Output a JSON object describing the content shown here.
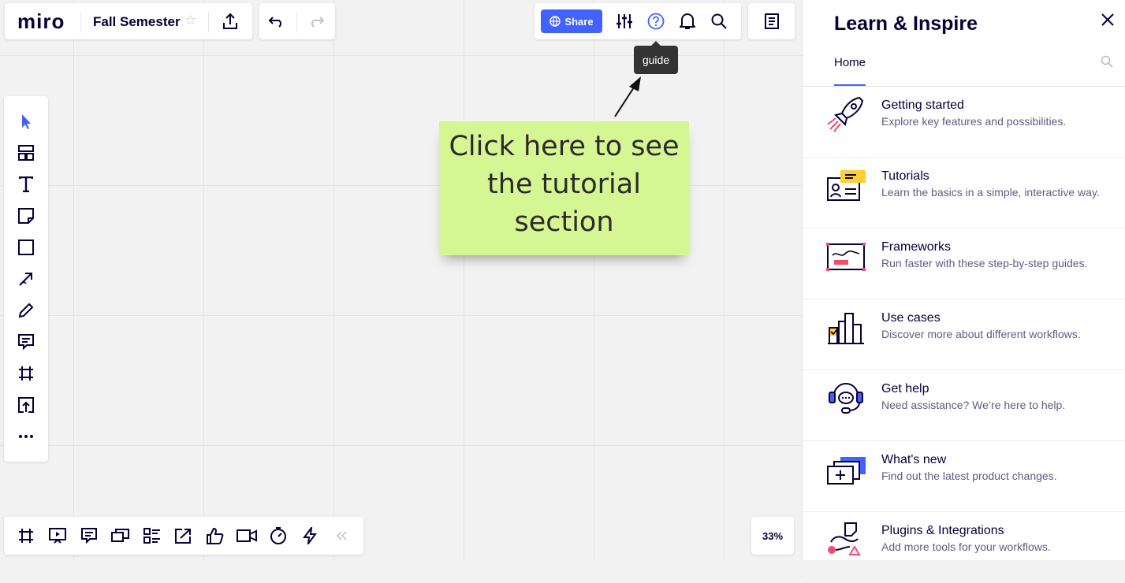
{
  "app": {
    "logo": "miro"
  },
  "board": {
    "title": "Fall Semester"
  },
  "top_bar": {
    "share_label": "Share"
  },
  "tooltip": {
    "text": "guide"
  },
  "sticky_note": {
    "text": "Click here to see the tutorial section",
    "color": "#d5f692"
  },
  "left_toolbar": {
    "tools": [
      "select-icon",
      "templates-icon",
      "text-icon",
      "sticky-note-icon",
      "shape-icon",
      "arrow-icon",
      "pen-icon",
      "comment-icon",
      "frame-icon",
      "upload-icon",
      "more-icon"
    ],
    "accent": "#4262ff"
  },
  "bottom_bar": {
    "tools": [
      "frames-icon",
      "presentation-icon",
      "comments-icon",
      "video-chat-icon",
      "card-icon",
      "screen-share-icon",
      "voting-icon",
      "video-icon",
      "timer-icon",
      "lightning-icon",
      "collapse-icon"
    ]
  },
  "zoom": {
    "level": "33%"
  },
  "sidebar": {
    "title": "Learn & Inspire",
    "tab": "Home",
    "items": [
      {
        "title": "Getting started",
        "desc": "Explore key features and possibilities.",
        "icon": "rocket-icon"
      },
      {
        "title": "Tutorials",
        "desc": "Learn the basics in a simple, interactive way.",
        "icon": "tutorials-icon"
      },
      {
        "title": "Frameworks",
        "desc": "Run faster with these step-by-step guides.",
        "icon": "frameworks-icon"
      },
      {
        "title": "Use cases",
        "desc": "Discover more about different workflows.",
        "icon": "use-cases-icon"
      },
      {
        "title": "Get help",
        "desc": "Need assistance? We’re here to help.",
        "icon": "headset-icon"
      },
      {
        "title": "What's new",
        "desc": "Find out the latest product changes.",
        "icon": "whats-new-icon"
      },
      {
        "title": "Plugins & Integrations",
        "desc": "Add more tools for your workflows.",
        "icon": "plugins-icon"
      }
    ]
  }
}
